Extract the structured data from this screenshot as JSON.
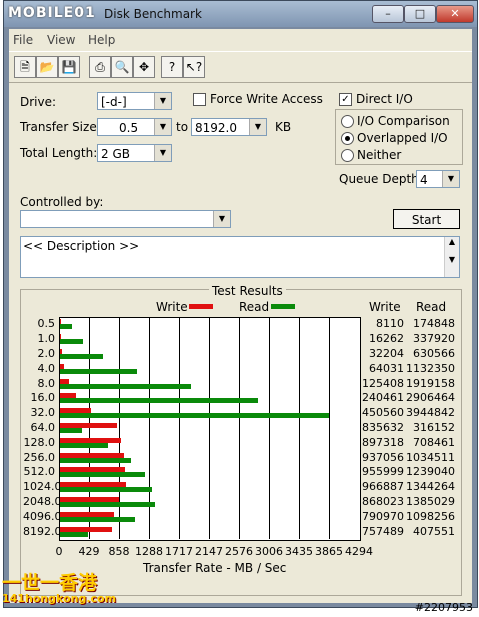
{
  "window": {
    "title": "Disk Benchmark",
    "watermark_logo": "MOBILE01"
  },
  "menubar": [
    "File",
    "View",
    "Help"
  ],
  "toolbar_icons": [
    "new-icon",
    "open-icon",
    "save-icon",
    "print-icon",
    "print-preview-icon",
    "move-icon",
    "help-icon",
    "context-help-icon"
  ],
  "settings": {
    "drive_label": "Drive:",
    "drive_value": "[-d-]",
    "transfer_size_label": "Transfer Size:",
    "transfer_from": "0.5",
    "to_label": "to",
    "transfer_to": "8192.0",
    "unit": "KB",
    "total_length_label": "Total Length:",
    "total_length_value": "2 GB",
    "force_write_label": "Force Write Access",
    "force_write_checked": false,
    "direct_io_label": "Direct I/O",
    "direct_io_checked": true,
    "io_comparison_label": "I/O Comparison",
    "overlapped_io_label": "Overlapped I/O",
    "neither_label": "Neither",
    "selected_mode": "Overlapped I/O",
    "queue_depth_label": "Queue Depth:",
    "queue_depth_value": "4",
    "controlled_by_label": "Controlled by:",
    "controlled_by_value": "",
    "start_button": "Start",
    "description": "<< Description >>"
  },
  "chart_data": {
    "type": "bar",
    "orientation": "horizontal",
    "title": "Test Results",
    "xlabel": "Transfer Rate - MB / Sec",
    "legend": [
      "Write",
      "Read"
    ],
    "colors": {
      "write": "#e01010",
      "read": "#0a8a0a"
    },
    "xlim": [
      0,
      4294
    ],
    "xticks": [
      "0",
      "429",
      "858",
      "1288",
      "1717",
      "2147",
      "2576",
      "3006",
      "3435",
      "3865",
      "4294"
    ],
    "categories": [
      "0.5",
      "1.0",
      "2.0",
      "4.0",
      "8.0",
      "16.0",
      "32.0",
      "64.0",
      "128.0",
      "256.0",
      "512.0",
      "1024.0",
      "2048.0",
      "4096.0",
      "8192.0"
    ],
    "write_header": "Write",
    "read_header": "Read",
    "write_values": [
      "8110",
      "16262",
      "32204",
      "64031",
      "125408",
      "240461",
      "450560",
      "835632",
      "897318",
      "937056",
      "955999",
      "966887",
      "868023",
      "790970",
      "757489"
    ],
    "read_values": [
      "174848",
      "337920",
      "630566",
      "1132350",
      "1919158",
      "2906464",
      "3944842",
      "316152",
      "708461",
      "1034511",
      "1239040",
      "1344264",
      "1385029",
      "1098256",
      "407551"
    ],
    "series": [
      {
        "name": "Write",
        "values": [
          8,
          16,
          31,
          63,
          122,
          235,
          440,
          816,
          876,
          915,
          934,
          944,
          848,
          772,
          740
        ]
      },
      {
        "name": "Read",
        "values": [
          171,
          330,
          616,
          1106,
          1874,
          2838,
          3852,
          309,
          692,
          1010,
          1210,
          1313,
          1353,
          1073,
          398
        ]
      }
    ]
  },
  "footer": {
    "brand_text": "一世一香港",
    "brand_site": "141hongkong.com",
    "watermark_id": "#2207953"
  }
}
